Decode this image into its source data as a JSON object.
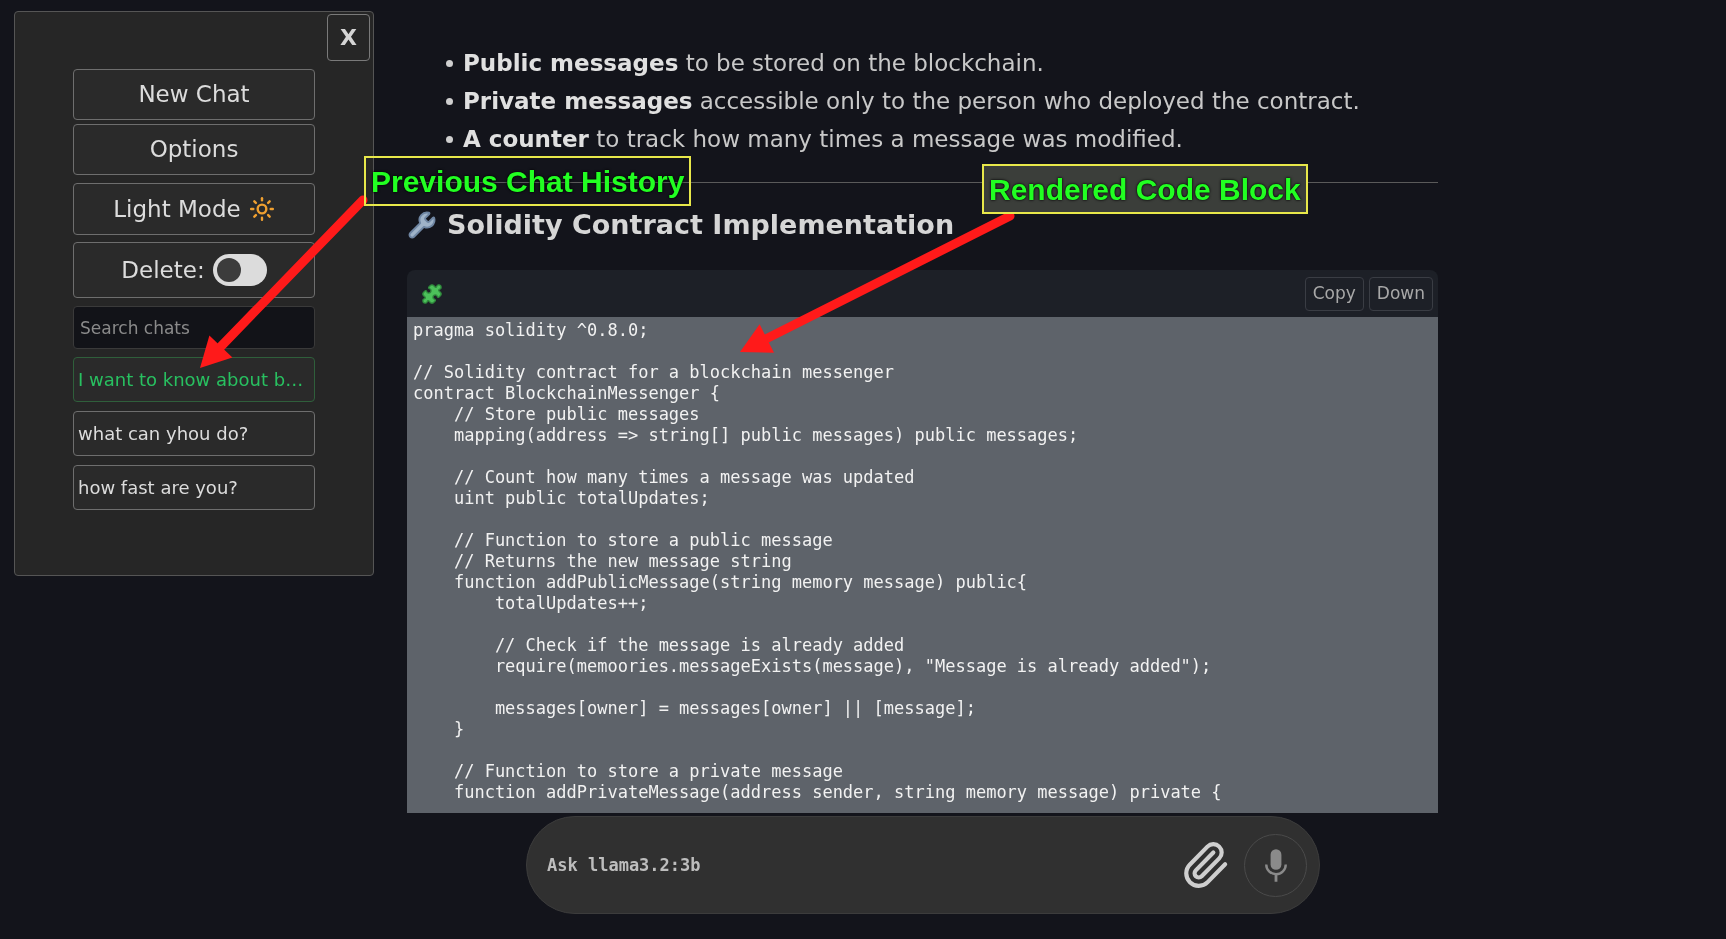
{
  "sidebar": {
    "close_button": "X",
    "buttons": [
      "New Chat",
      "Options"
    ],
    "theme_button": "Light Mode",
    "delete_toggle": {
      "label": "Delete:",
      "on": false
    },
    "search": {
      "placeholder": "Search chats"
    },
    "chats": [
      {
        "title": "I want to know about b…",
        "selected": true
      },
      {
        "title": "what can yhou do?",
        "selected": false
      },
      {
        "title": "how fast are you?",
        "selected": false
      }
    ]
  },
  "content": {
    "bullets": [
      "**Public messages** to be stored on the blockchain.",
      "**Private messages** accessible only to the person who deployed the contract.",
      "**A counter** to track how many times a message was modified."
    ],
    "heading": "Solidity Contract Implementation",
    "code_block": {
      "buttons": [
        "Copy",
        "Down"
      ],
      "code": "pragma solidity ^0.8.0;\n\n// Solidity contract for a blockchain messenger\ncontract BlockchainMessenger {\n    // Store public messages\n    mapping(address => string[] public messages) public messages;\n\n    // Count how many times a message was updated\n    uint public totalUpdates;\n\n    // Function to store a public message\n    // Returns the new message string\n    function addPublicMessage(string memory message) public{\n        totalUpdates++;\n\n        // Check if the message is already added\n        require(memoories.messageExists(message), \"Message is already added\");\n\n        messages[owner] = messages[owner] || [message];\n    }\n\n    // Function to store a private message\n    function addPrivateMessage(address sender, string memory message) private {"
    }
  },
  "composer": {
    "placeholder": "Ask llama3.2:3b"
  },
  "annotations": [
    {
      "label": "Previous Chat History"
    },
    {
      "label": "Rendered Code Block"
    }
  ]
}
